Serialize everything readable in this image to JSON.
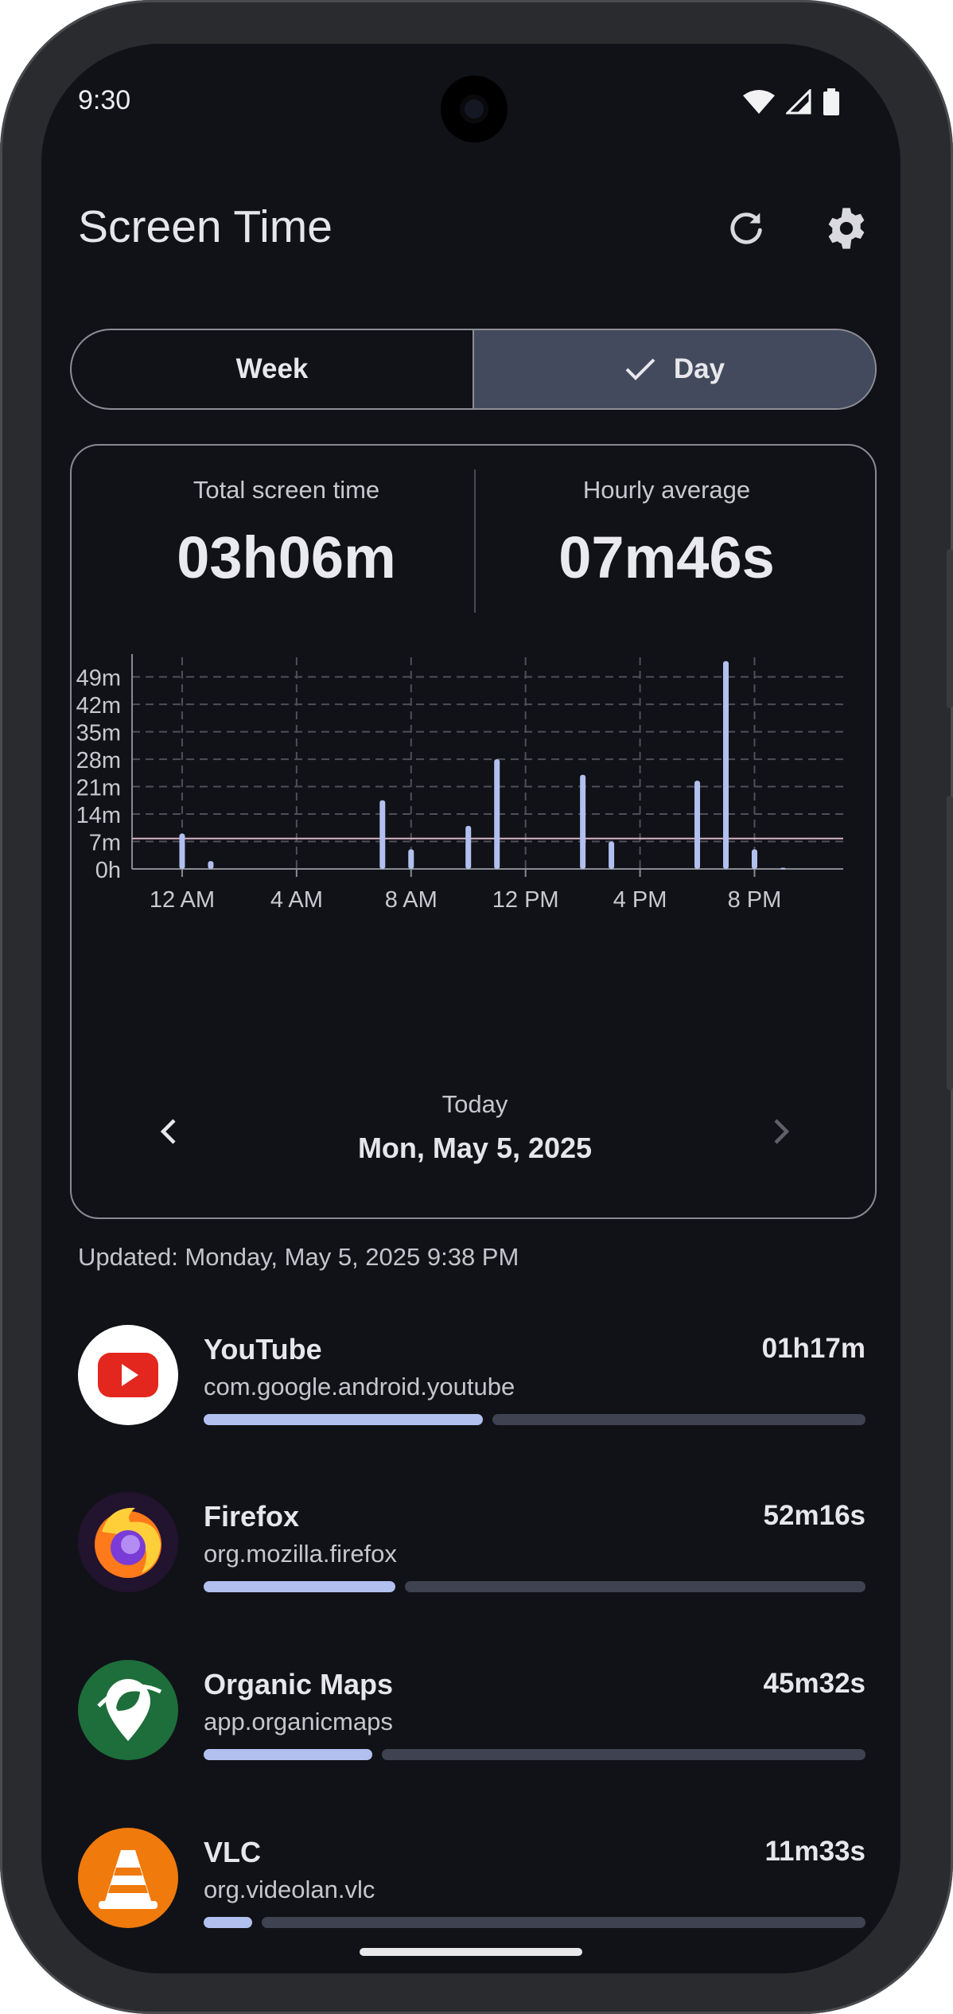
{
  "status": {
    "time": "9:30"
  },
  "header": {
    "title": "Screen Time",
    "refresh_icon": "refresh-icon",
    "settings_icon": "gear-icon"
  },
  "tabs": [
    {
      "label": "Week",
      "selected": false
    },
    {
      "label": "Day",
      "selected": true
    }
  ],
  "summary": {
    "total_label": "Total screen time",
    "total_value": "03h06m",
    "avg_label": "Hourly average",
    "avg_value": "07m46s"
  },
  "chart_data": {
    "type": "bar",
    "y_ticks": [
      "0h",
      "7m",
      "14m",
      "21m",
      "28m",
      "35m",
      "42m",
      "49m"
    ],
    "y_tick_values": [
      0,
      7,
      14,
      21,
      28,
      35,
      42,
      49
    ],
    "x_ticks": [
      "12 AM",
      "4 AM",
      "8 AM",
      "12 PM",
      "4 PM",
      "8 PM"
    ],
    "x_tick_hours": [
      0,
      4,
      8,
      12,
      16,
      20
    ],
    "hours": [
      0,
      1,
      7,
      8,
      10,
      11,
      14,
      15,
      18,
      19,
      20,
      21
    ],
    "values": [
      9,
      2,
      17.5,
      5,
      11,
      28,
      24,
      7,
      22.5,
      53,
      5,
      0.3
    ],
    "average_line": 7.77,
    "ylim": [
      0,
      54
    ],
    "xlim": [
      -1.75,
      23.1
    ],
    "bar_color": "#b2c0ef",
    "average_color": "#d8b4c4",
    "grid": true
  },
  "date_nav": {
    "sub": "Today",
    "main": "Mon, May 5, 2025"
  },
  "updated": "Updated: Monday, May 5, 2025 9:38 PM",
  "apps": [
    {
      "name": "YouTube",
      "package": "com.google.android.youtube",
      "time": "01h17m",
      "fraction": 0.422,
      "icon": "youtube-icon"
    },
    {
      "name": "Firefox",
      "package": "org.mozilla.firefox",
      "time": "52m16s",
      "fraction": 0.29,
      "icon": "firefox-icon"
    },
    {
      "name": "Organic Maps",
      "package": "app.organicmaps",
      "time": "45m32s",
      "fraction": 0.255,
      "icon": "organic-maps-icon"
    },
    {
      "name": "VLC",
      "package": "org.videolan.vlc",
      "time": "11m33s",
      "fraction": 0.073,
      "icon": "vlc-icon"
    }
  ]
}
